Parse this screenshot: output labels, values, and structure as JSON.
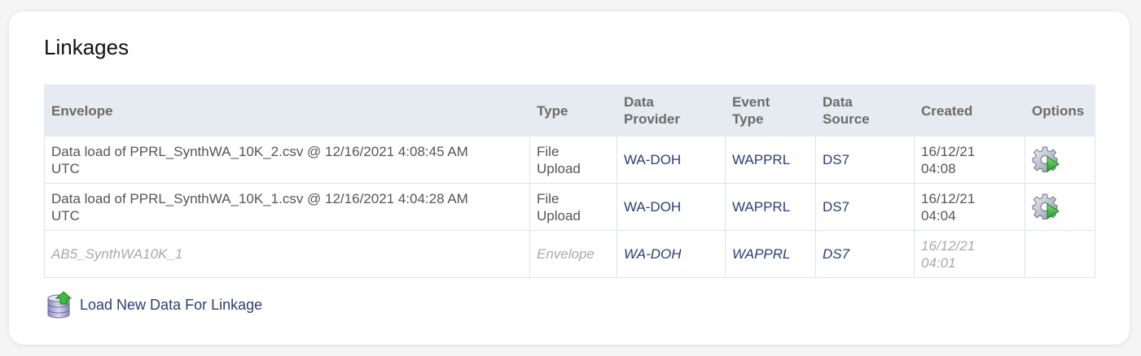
{
  "page": {
    "title": "Linkages"
  },
  "table": {
    "headers": {
      "envelope": "Envelope",
      "type": "Type",
      "data_provider_1": "Data",
      "data_provider_2": "Provider",
      "event_type_1": "Event",
      "event_type_2": "Type",
      "data_source_1": "Data",
      "data_source_2": "Source",
      "created": "Created",
      "options": "Options"
    },
    "rows": [
      {
        "envelope_1": "Data load of PPRL_SynthWA_10K_2.csv @ 12/16/2021 4:08:45 AM",
        "envelope_2": "UTC",
        "type_1": "File",
        "type_2": "Upload",
        "data_provider": "WA-DOH",
        "event_type": "WAPPRL",
        "data_source": "DS7",
        "created_1": "16/12/21",
        "created_2": "04:08",
        "option_icon": "gear-play-icon"
      },
      {
        "envelope_1": "Data load of PPRL_SynthWA_10K_1.csv @ 12/16/2021 4:04:28 AM",
        "envelope_2": "UTC",
        "type_1": "File",
        "type_2": "Upload",
        "data_provider": "WA-DOH",
        "event_type": "WAPPRL",
        "data_source": "DS7",
        "created_1": "16/12/21",
        "created_2": "04:04",
        "option_icon": "gear-play-icon"
      },
      {
        "envelope_1": "AB5_SynthWA10K_1",
        "envelope_2": "",
        "type_1": "Envelope",
        "type_2": "",
        "data_provider": "WA-DOH",
        "event_type": "WAPPRL",
        "data_source": "DS7",
        "created_1": "16/12/21",
        "created_2": "04:01",
        "option_icon": ""
      }
    ]
  },
  "actions": {
    "load_new_data_label": "Load New Data For Linkage",
    "load_new_data_icon": "database-upload-icon"
  },
  "colors": {
    "header_bg": "#e6ebf2",
    "link": "#2c3e73",
    "muted_text": "#a9a9a9",
    "body_text": "#555555"
  }
}
